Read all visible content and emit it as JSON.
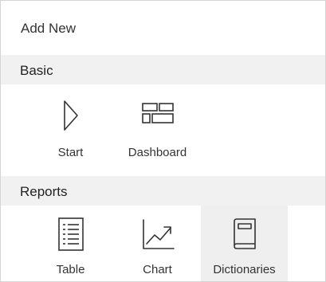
{
  "panel": {
    "title": "Add New"
  },
  "sections": [
    {
      "title": "Basic",
      "tiles": [
        {
          "label": "Start",
          "icon": "play-triangle-icon"
        },
        {
          "label": "Dashboard",
          "icon": "dashboard-layout-icon"
        }
      ]
    },
    {
      "title": "Reports",
      "tiles": [
        {
          "label": "Table",
          "icon": "table-document-icon"
        },
        {
          "label": "Chart",
          "icon": "line-chart-icon"
        },
        {
          "label": "Dictionaries",
          "icon": "book-icon",
          "selected": true
        }
      ]
    }
  ],
  "colors": {
    "section_background": "#f1f1f1",
    "selected_tile": "#efefef",
    "icon_stroke": "#333333",
    "border": "#d4d4d4"
  }
}
